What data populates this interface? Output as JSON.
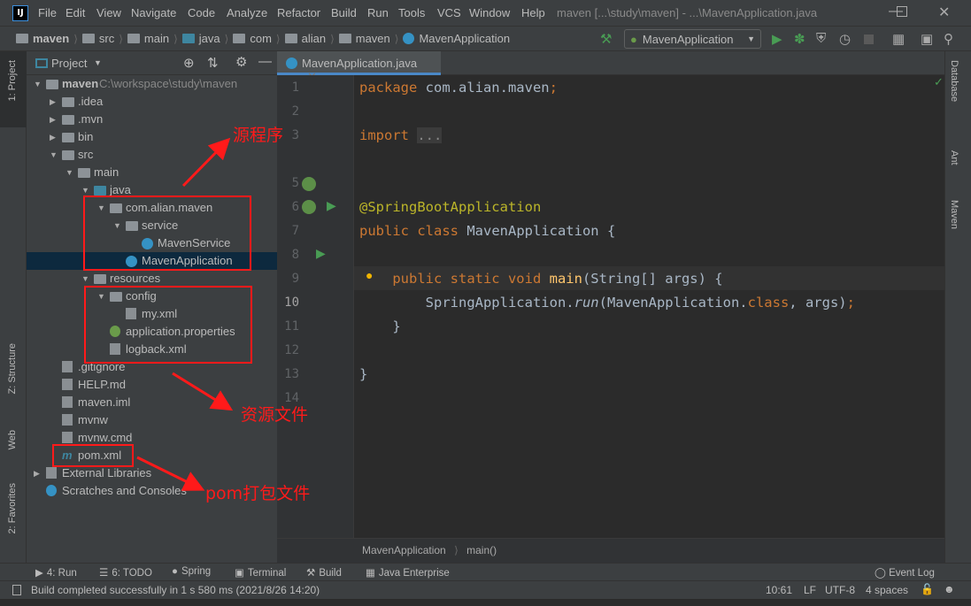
{
  "titlebar": {
    "logo": "IJ",
    "menu": [
      "File",
      "Edit",
      "View",
      "Navigate",
      "Code",
      "Analyze",
      "Refactor",
      "Build",
      "Run",
      "Tools",
      "VCS",
      "Window",
      "Help"
    ],
    "window_title": "maven [...\\study\\maven] - ...\\MavenApplication.java"
  },
  "navbar": {
    "crumbs": [
      "maven",
      "src",
      "main",
      "java",
      "com",
      "alian",
      "maven",
      "MavenApplication"
    ],
    "run_config": "MavenApplication"
  },
  "left_strip": {
    "project": "1: Project",
    "structure": "Z: Structure",
    "web": "Web",
    "favorites": "2: Favorites"
  },
  "right_strip": {
    "database": "Database",
    "ant": "Ant",
    "maven": "Maven"
  },
  "project_panel": {
    "title": "Project",
    "root_path": "C:\\workspace\\study\\maven",
    "tree": [
      {
        "label": "maven",
        "level": 0,
        "arrow": "down",
        "icon": "module"
      },
      {
        "label": ".idea",
        "level": 1,
        "arrow": "right",
        "icon": "folder"
      },
      {
        "label": ".mvn",
        "level": 1,
        "arrow": "right",
        "icon": "folder"
      },
      {
        "label": "bin",
        "level": 1,
        "arrow": "right",
        "icon": "folder"
      },
      {
        "label": "src",
        "level": 1,
        "arrow": "down",
        "icon": "folder"
      },
      {
        "label": "main",
        "level": 2,
        "arrow": "down",
        "icon": "folder"
      },
      {
        "label": "java",
        "level": 3,
        "arrow": "down",
        "icon": "source-folder"
      },
      {
        "label": "com.alian.maven",
        "level": 4,
        "arrow": "down",
        "icon": "package"
      },
      {
        "label": "service",
        "level": 5,
        "arrow": "down",
        "icon": "package"
      },
      {
        "label": "MavenService",
        "level": 6,
        "arrow": "",
        "icon": "class"
      },
      {
        "label": "MavenApplication",
        "level": 5,
        "arrow": "",
        "icon": "spring-class",
        "selected": true
      },
      {
        "label": "resources",
        "level": 3,
        "arrow": "down",
        "icon": "resources-folder"
      },
      {
        "label": "config",
        "level": 4,
        "arrow": "down",
        "icon": "folder"
      },
      {
        "label": "my.xml",
        "level": 5,
        "arrow": "",
        "icon": "xml"
      },
      {
        "label": "application.properties",
        "level": 4,
        "arrow": "",
        "icon": "properties"
      },
      {
        "label": "logback.xml",
        "level": 4,
        "arrow": "",
        "icon": "xml"
      },
      {
        "label": ".gitignore",
        "level": 1,
        "arrow": "",
        "icon": "file"
      },
      {
        "label": "HELP.md",
        "level": 1,
        "arrow": "",
        "icon": "file"
      },
      {
        "label": "maven.iml",
        "level": 1,
        "arrow": "",
        "icon": "file"
      },
      {
        "label": "mvnw",
        "level": 1,
        "arrow": "",
        "icon": "file"
      },
      {
        "label": "mvnw.cmd",
        "level": 1,
        "arrow": "",
        "icon": "file"
      },
      {
        "label": "pom.xml",
        "level": 1,
        "arrow": "",
        "icon": "maven"
      },
      {
        "label": "External Libraries",
        "level": 0,
        "arrow": "right",
        "icon": "library"
      },
      {
        "label": "Scratches and Consoles",
        "level": 0,
        "arrow": "",
        "icon": "scratches"
      }
    ]
  },
  "editor": {
    "tab": "MavenApplication.java",
    "current_line": 10,
    "lines": [
      [
        [
          "package ",
          "kw"
        ],
        [
          "com.alian.maven",
          ""
        ],
        [
          ";",
          "kw"
        ]
      ],
      [],
      [
        [
          "import ",
          "kw"
        ],
        [
          "...",
          "fold2"
        ]
      ],
      [],
      [],
      [
        [
          "@SpringBootApplication",
          "ann"
        ]
      ],
      [
        [
          "public class ",
          "kw"
        ],
        [
          "MavenApplication {",
          ""
        ]
      ],
      [],
      [
        [
          "    public static void ",
          "kw"
        ],
        [
          "main",
          "fn"
        ],
        [
          "(String[] args) {",
          ""
        ]
      ],
      [
        [
          "        SpringApplication.",
          ""
        ],
        [
          "run",
          "it"
        ],
        [
          "(MavenApplication.",
          ""
        ],
        [
          "class",
          "kw"
        ],
        [
          ", args)",
          ""
        ],
        [
          ";",
          "kw"
        ]
      ],
      [
        [
          "    }",
          ""
        ]
      ],
      [],
      [
        [
          "}",
          ""
        ]
      ],
      []
    ],
    "line_numbers": [
      "1",
      "2",
      "3",
      "",
      "5",
      "6",
      "7",
      "8",
      "9",
      "10",
      "11",
      "12",
      "13",
      "14"
    ],
    "breadcrumb": [
      "MavenApplication",
      "main()"
    ]
  },
  "tool_windows": [
    "4: Run",
    "6: TODO",
    "Spring",
    "Terminal",
    "Build",
    "Java Enterprise"
  ],
  "event_log": "Event Log",
  "status": {
    "message": "Build completed successfully in 1 s 580 ms (2021/8/26 14:20)",
    "position": "10:61",
    "line_sep": "LF",
    "encoding": "UTF-8",
    "indent": "4 spaces"
  },
  "annotations": {
    "source": "源程序",
    "resources": "资源文件",
    "pom": "pom打包文件",
    "color": "#ff1a1a"
  }
}
